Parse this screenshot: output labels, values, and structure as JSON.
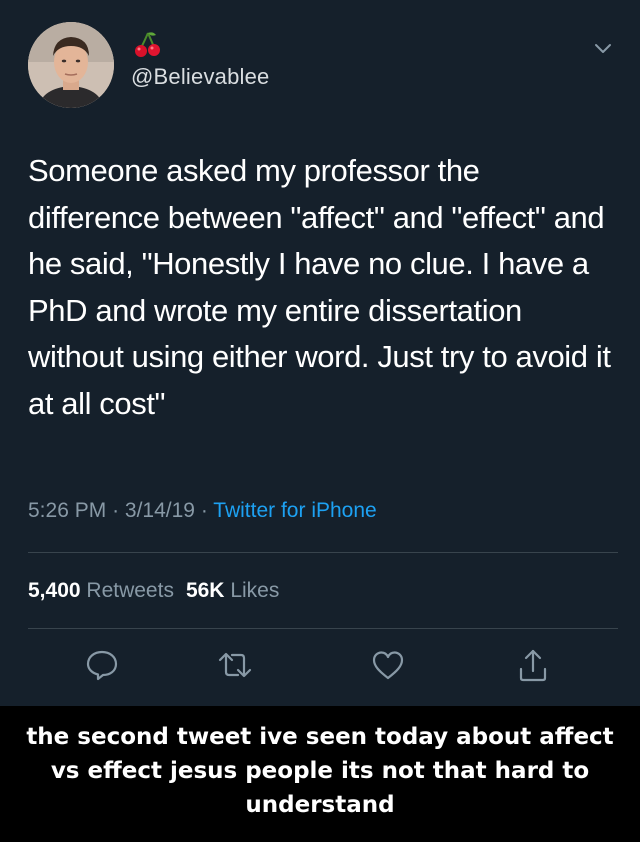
{
  "tweet": {
    "handle": "@Believablee",
    "name_emoji_icon": "cherries-emoji",
    "text": "Someone asked my professor the difference between \"affect\" and \"effect\" and he said, \"Honestly I have no clue. I have a PhD and wrote my entire dissertation without using either word. Just try to avoid it at all cost\"",
    "time": "5:26 PM",
    "date": "3/14/19",
    "separator": "·",
    "source": "Twitter for iPhone",
    "retweets_count": "5,400",
    "retweets_label": "Retweets",
    "likes_count": "56K",
    "likes_label": "Likes"
  },
  "actions": [
    "reply-icon",
    "retweet-icon",
    "like-icon",
    "share-icon"
  ],
  "caption": {
    "lines": [
      "the second tweet ive seen today about affect",
      "vs effect jesus people its not that hard to",
      "understand"
    ]
  },
  "colors": {
    "background": "#15202b",
    "text": "#ffffff",
    "secondary": "#8899a6",
    "link": "#1da1f2",
    "divider": "#38444d"
  }
}
